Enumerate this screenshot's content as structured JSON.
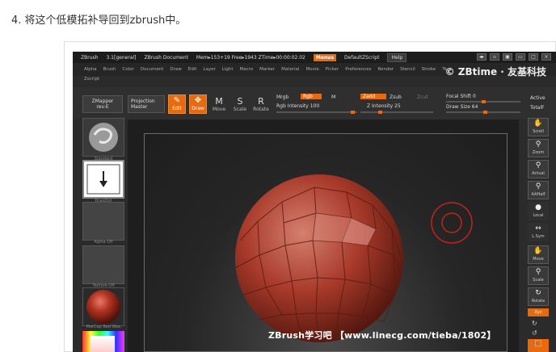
{
  "heading": "4. 将这个低模拓补导回到zbrush中。",
  "titlebar": {
    "app": "ZBrush",
    "version": "3.1[general]",
    "doc": "ZBrush Document",
    "mem": "Mem▸153+19 Free▸1943 ZTime▸00:00:02.02",
    "menus": "Menus",
    "script": "DefaultZScript",
    "help": "Help"
  },
  "menubar": [
    "Alpha",
    "Brush",
    "Color",
    "Document",
    "Draw",
    "Edit",
    "Layer",
    "Light",
    "Macro",
    "Marker",
    "Material",
    "Movie",
    "Picker",
    "Preferences",
    "Render",
    "Stencil",
    "Stroke",
    "Te"
  ],
  "zscript": "Zscript",
  "watermark": "© ZBtime · 友基科技",
  "toolbar": {
    "zmapper": "ZMapper",
    "zmapper_sub": "rev-E",
    "projection": "Projection",
    "projection_sub": "Master",
    "edit": "Edit",
    "draw": "Draw",
    "move": "Move",
    "scale": "Scale",
    "rotate": "Rotate",
    "mrgb": "Mrgb",
    "rgb": "Rgb",
    "m": "M",
    "rgb_intensity": "Rgb Intensity 100",
    "zadd": "Zadd",
    "zsub": "Zsub",
    "zcut": "Zcut",
    "z_intensity": "Z Intensity 25",
    "focal_shift": "Focal Shift 0",
    "draw_size": "Draw Size 64",
    "active": "Active",
    "total": "TotalF"
  },
  "leftshelf": {
    "standard": "Standard",
    "dragdot": "DragDot",
    "alpha": "Alpha Off",
    "texture": "Texture Off",
    "matcap": "MatCap Red Wax"
  },
  "rightshelf": [
    "Scroll",
    "Zoom",
    "Actual",
    "AAHalf",
    "Local",
    "L.Sym",
    "Move",
    "Scale",
    "Rotate",
    "Xyz"
  ],
  "caption": "ZBrush学习吧 【www.linecg.com/tieba/1802】",
  "colors": {
    "accent": "#e86a10",
    "mesh": "#a83a2a"
  }
}
